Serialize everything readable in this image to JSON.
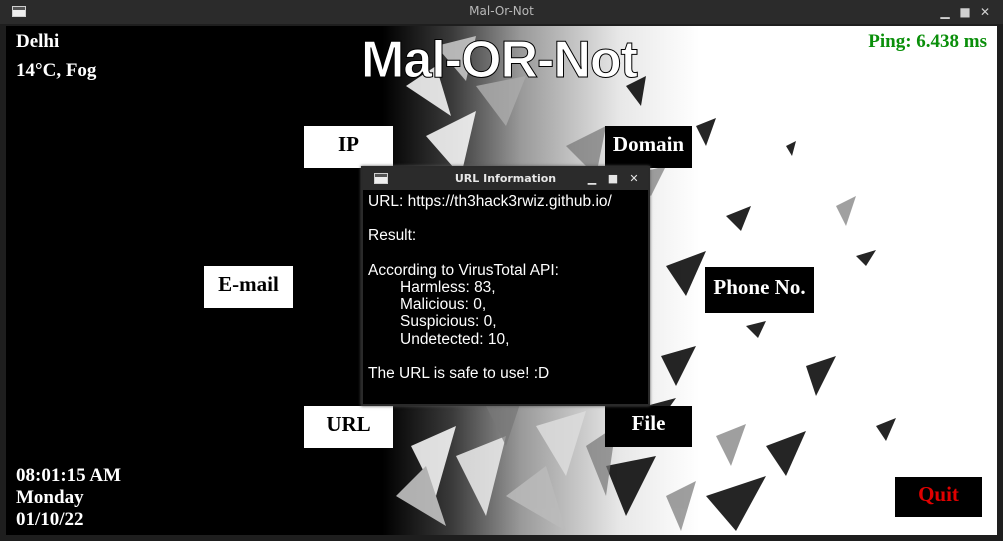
{
  "window": {
    "title": "Mal-Or-Not"
  },
  "app": {
    "heading": "Mal-OR-Not"
  },
  "weather": {
    "city": "Delhi",
    "condition": "14°C, Fog"
  },
  "ping": {
    "text": "Ping: 6.438 ms",
    "color": "#0a8f0a"
  },
  "clock": {
    "time": "08:01:15 AM",
    "day": "Monday",
    "date": "01/10/22"
  },
  "buttons": {
    "ip": "IP",
    "domain": "Domain",
    "email": "E-mail",
    "phone": "Phone No.",
    "url": "URL",
    "file": "File",
    "quit": "Quit"
  },
  "dialog": {
    "title": "URL Information",
    "url_line": "URL: https://th3hack3rwiz.github.io/",
    "result_label": "Result:",
    "source_line": "According to VirusTotal API:",
    "stats": [
      "Harmless: 83,",
      "Malicious: 0,",
      "Suspicious: 0,",
      "Undetected: 10,"
    ],
    "verdict": "The URL is safe to use! :D"
  },
  "colors": {
    "quit_text": "#e00000",
    "accent_ping": "#0a8f0a"
  }
}
